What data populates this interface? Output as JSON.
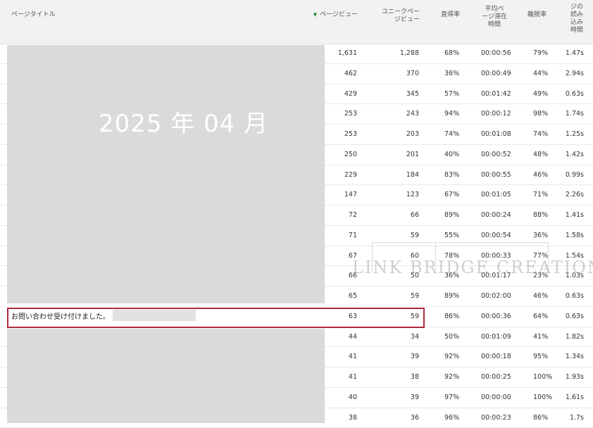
{
  "header": {
    "page_title": "ページタイトル",
    "pageviews": "ページビュー",
    "unique_pageviews": "ユニークページビュー",
    "bounce_rate": "直帰率",
    "avg_time": "平均ページ滞在時間",
    "exit_rate": "離脱率",
    "load_time": "ページの読み込み時間"
  },
  "overlay": {
    "month": "2025 年 04 月",
    "highlight_title": "お問い合わせ受け付けました。 |",
    "watermark": "LINK BRIDGE CREATION"
  },
  "rows": [
    {
      "pv": "1,631",
      "uniq": "1,288",
      "bounce": "68%",
      "avg": "00:00:56",
      "exit": "79%",
      "load": "1.47s"
    },
    {
      "pv": "462",
      "uniq": "370",
      "bounce": "36%",
      "avg": "00:00:49",
      "exit": "44%",
      "load": "2.94s"
    },
    {
      "pv": "429",
      "uniq": "345",
      "bounce": "57%",
      "avg": "00:01:42",
      "exit": "49%",
      "load": "0.63s"
    },
    {
      "pv": "253",
      "uniq": "243",
      "bounce": "94%",
      "avg": "00:00:12",
      "exit": "98%",
      "load": "1.74s"
    },
    {
      "pv": "253",
      "uniq": "203",
      "bounce": "74%",
      "avg": "00:01:08",
      "exit": "74%",
      "load": "1.25s"
    },
    {
      "pv": "250",
      "uniq": "201",
      "bounce": "40%",
      "avg": "00:00:52",
      "exit": "48%",
      "load": "1.42s"
    },
    {
      "pv": "229",
      "uniq": "184",
      "bounce": "83%",
      "avg": "00:00:55",
      "exit": "46%",
      "load": "0.99s"
    },
    {
      "pv": "147",
      "uniq": "123",
      "bounce": "67%",
      "avg": "00:01:05",
      "exit": "71%",
      "load": "2.26s"
    },
    {
      "pv": "72",
      "uniq": "66",
      "bounce": "89%",
      "avg": "00:00:24",
      "exit": "88%",
      "load": "1.41s"
    },
    {
      "pv": "71",
      "uniq": "59",
      "bounce": "55%",
      "avg": "00:00:54",
      "exit": "36%",
      "load": "1.58s"
    },
    {
      "pv": "67",
      "uniq": "60",
      "bounce": "78%",
      "avg": "00:00:33",
      "exit": "77%",
      "load": "1.54s"
    },
    {
      "pv": "66",
      "uniq": "50",
      "bounce": "36%",
      "avg": "00:01:17",
      "exit": "23%",
      "load": "1.03s"
    },
    {
      "pv": "65",
      "uniq": "59",
      "bounce": "89%",
      "avg": "00:02:00",
      "exit": "46%",
      "load": "0.63s"
    },
    {
      "pv": "63",
      "uniq": "59",
      "bounce": "86%",
      "avg": "00:00:36",
      "exit": "64%",
      "load": "0.63s"
    },
    {
      "pv": "44",
      "uniq": "34",
      "bounce": "50%",
      "avg": "00:01:09",
      "exit": "41%",
      "load": "1.82s"
    },
    {
      "pv": "41",
      "uniq": "39",
      "bounce": "92%",
      "avg": "00:00:18",
      "exit": "95%",
      "load": "1.34s"
    },
    {
      "pv": "41",
      "uniq": "38",
      "bounce": "92%",
      "avg": "00:00:25",
      "exit": "100%",
      "load": "1.93s"
    },
    {
      "pv": "40",
      "uniq": "39",
      "bounce": "97%",
      "avg": "00:00:00",
      "exit": "100%",
      "load": "1.61s"
    },
    {
      "pv": "38",
      "uniq": "36",
      "bounce": "96%",
      "avg": "00:00:23",
      "exit": "86%",
      "load": "1.7s"
    }
  ]
}
